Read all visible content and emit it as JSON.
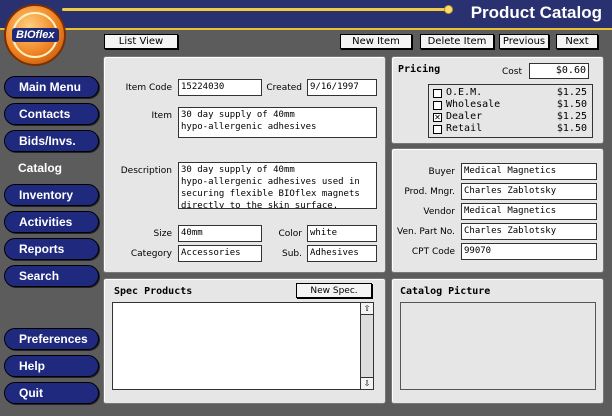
{
  "window": {
    "title": "Product Catalog",
    "logo": "BIOflex"
  },
  "toolbar": {
    "list_view": "List View",
    "new_item": "New Item",
    "delete_item": "Delete Item",
    "previous": "Previous",
    "next": "Next"
  },
  "sidebar": {
    "items": [
      {
        "label": "Main Menu"
      },
      {
        "label": "Contacts"
      },
      {
        "label": "Bids/Invs."
      },
      {
        "label": "Catalog"
      },
      {
        "label": "Inventory"
      },
      {
        "label": "Activities"
      },
      {
        "label": "Reports"
      },
      {
        "label": "Search"
      },
      {
        "label": "Preferences"
      },
      {
        "label": "Help"
      },
      {
        "label": "Quit"
      }
    ]
  },
  "item": {
    "item_code_label": "Item Code",
    "item_code": "15224030",
    "created_label": "Created",
    "created": "9/16/1997",
    "item_label": "Item",
    "item": "30 day supply of 40mm\nhypo-allergenic adhesives",
    "description_label": "Description",
    "description": "30 day supply of 40mm\nhypo-allergenic adhesives used in\nsecuring flexible BIOflex magnets\ndirectly to the skin surface.",
    "size_label": "Size",
    "size": "40mm",
    "color_label": "Color",
    "color": "white",
    "category_label": "Category",
    "category": "Accessories",
    "sub_label": "Sub.",
    "sub": "Adhesives"
  },
  "pricing": {
    "title": "Pricing",
    "cost_label": "Cost",
    "cost": "$0.60",
    "options": [
      {
        "label": "O.E.M.",
        "price": "$1.25",
        "checked": false
      },
      {
        "label": "Wholesale",
        "price": "$1.50",
        "checked": false
      },
      {
        "label": "Dealer",
        "price": "$1.25",
        "checked": true
      },
      {
        "label": "Retail",
        "price": "$1.50",
        "checked": false
      }
    ]
  },
  "vendor": {
    "buyer_label": "Buyer",
    "buyer": "Medical Magnetics",
    "prod_mngr_label": "Prod. Mngr.",
    "prod_mngr": "Charles Zablotsky",
    "vendor_label": "Vendor",
    "vendor": "Medical Magnetics",
    "ven_part_label": "Ven. Part No.",
    "ven_part": "Charles Zablotsky",
    "cpt_label": "CPT Code",
    "cpt": "99070"
  },
  "spec": {
    "title": "Spec Products",
    "new_spec": "New Spec."
  },
  "picture": {
    "title": "Catalog Picture"
  }
}
